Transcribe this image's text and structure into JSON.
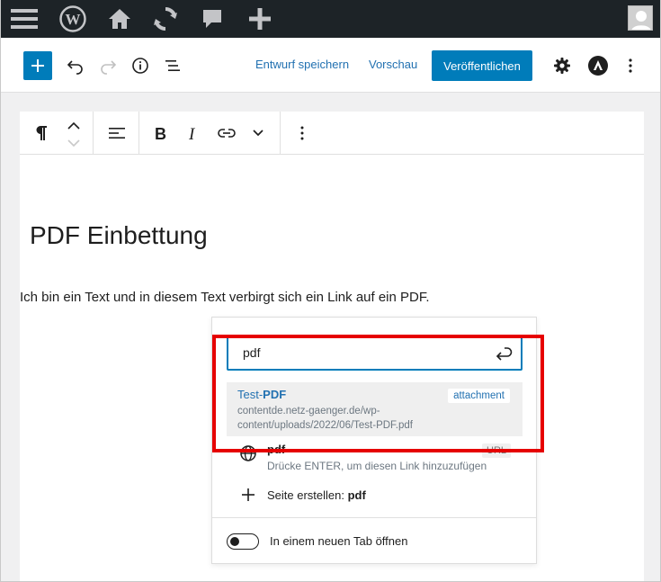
{
  "colors": {
    "admin_bar": "#1d2327",
    "primary": "#007cba",
    "link": "#2271b1",
    "highlight": "#e60000"
  },
  "admin_bar": {
    "icons": [
      "menu-icon",
      "wordpress-logo-icon",
      "home-icon",
      "updates-icon",
      "comments-icon",
      "new-content-icon",
      "user-avatar"
    ]
  },
  "editor_header": {
    "save_draft": "Entwurf speichern",
    "preview": "Vorschau",
    "publish": "Veröffentlichen"
  },
  "block_toolbar": {
    "icons": [
      "paragraph-icon",
      "move-up-icon",
      "move-down-icon",
      "align-icon",
      "bold-icon",
      "italic-icon",
      "link-icon",
      "more-formatting-icon",
      "options-icon"
    ]
  },
  "content": {
    "heading": "PDF Einbettung",
    "paragraph": "Ich bin ein Text und in diesem Text verbirgt sich ein Link auf ein PDF."
  },
  "link_popover": {
    "input_value": "pdf",
    "suggestions": [
      {
        "title_prefix": "Test-",
        "title_match": "PDF",
        "url": "contentde.netz-gaenger.de/wp-content/uploads/2022/06/Test-PDF.pdf",
        "type": "attachment"
      },
      {
        "title": "pdf",
        "subtitle": "Drücke ENTER, um diesen Link hinzuzufügen",
        "type": "URL"
      }
    ],
    "create_page_label": "Seite erstellen: ",
    "create_page_value": "pdf",
    "new_tab_label": "In einem neuen Tab öffnen",
    "new_tab_enabled": false
  }
}
